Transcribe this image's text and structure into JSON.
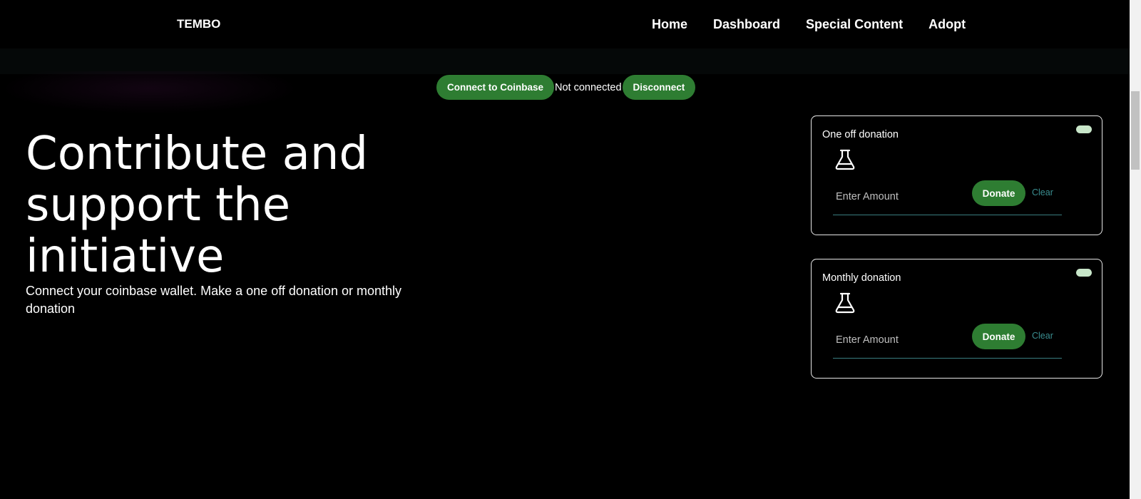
{
  "nav": {
    "brand": "TEMBO",
    "links": [
      "Home",
      "Dashboard",
      "Special Content",
      "Adopt"
    ]
  },
  "wallet": {
    "connect_label": "Connect to Coinbase",
    "status": "Not connected",
    "disconnect_label": "Disconnect"
  },
  "hero": {
    "title": "Contribute and support the initiative",
    "subtitle": "Connect your coinbase wallet. Make a one off donation or monthly donation"
  },
  "cards": [
    {
      "title": "One off donation",
      "icon": "flask-icon",
      "placeholder": "Enter Amount",
      "donate_label": "Donate",
      "clear_label": "Clear"
    },
    {
      "title": "Monthly donation",
      "icon": "flask-icon",
      "placeholder": "Enter Amount",
      "donate_label": "Donate",
      "clear_label": "Clear"
    }
  ],
  "colors": {
    "background": "#000000",
    "button_green": "#2e7d32",
    "clear_teal": "#3a8e90",
    "toggle": "#c8e6c9"
  }
}
